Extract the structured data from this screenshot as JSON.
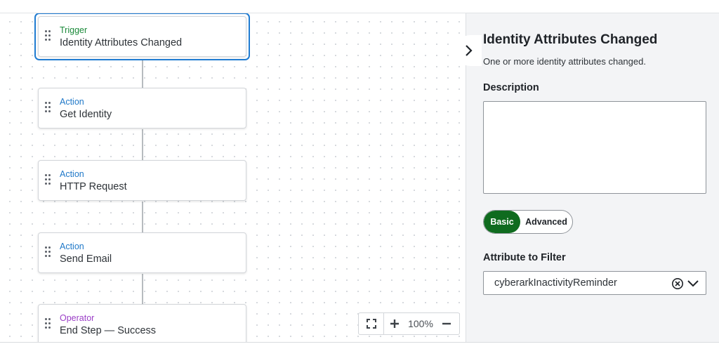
{
  "flow": {
    "nodes": [
      {
        "type": "Trigger",
        "name": "Identity Attributes Changed"
      },
      {
        "type": "Action",
        "name": "Get Identity"
      },
      {
        "type": "Action",
        "name": "HTTP Request"
      },
      {
        "type": "Action",
        "name": "Send Email"
      },
      {
        "type": "Operator",
        "name": "End Step — Success"
      }
    ],
    "selected_index": 0
  },
  "zoom": {
    "level": "100%"
  },
  "panel": {
    "title": "Identity Attributes Changed",
    "subtitle": "One or more identity attributes changed.",
    "description_label": "Description",
    "description_value": "",
    "toggle": {
      "basic_label": "Basic",
      "advanced_label": "Advanced",
      "active": "Basic"
    },
    "attribute_label": "Attribute to Filter",
    "attribute_value": "cyberarkInactivityReminder"
  },
  "colors": {
    "trigger": "#1b8a3a",
    "action": "#1f78c8",
    "operator": "#9b3fc7",
    "selected": "#1f7bd1",
    "toggle_active": "#0f6b1f"
  },
  "icons": [
    "drag-handle-icon",
    "chevron-right-icon",
    "fit-screen-icon",
    "plus-icon",
    "minus-icon",
    "clear-circle-icon",
    "chevron-down-icon"
  ]
}
